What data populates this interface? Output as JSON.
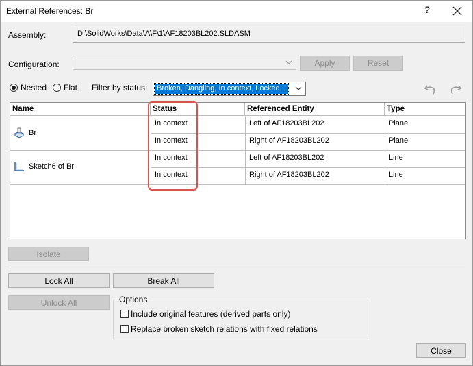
{
  "window": {
    "title": "External References: Br",
    "help_label": "?"
  },
  "assembly": {
    "label": "Assembly:",
    "value": "D:\\SolidWorks\\Data\\A\\F\\1\\AF18203BL202.SLDASM"
  },
  "configuration": {
    "label": "Configuration:",
    "value": "",
    "apply_label": "Apply",
    "reset_label": "Reset"
  },
  "view_mode": {
    "nested_label": "Nested",
    "flat_label": "Flat",
    "selected": "Nested"
  },
  "filter": {
    "label": "Filter by status:",
    "value": "Broken, Dangling, In context, Locked..."
  },
  "table": {
    "headers": {
      "name": "Name",
      "status": "Status",
      "entity": "Referenced Entity",
      "type": "Type"
    },
    "groups": [
      {
        "name": "Br",
        "icon": "part-feature-icon"
      },
      {
        "name": "Sketch6  of  Br",
        "icon": "sketch-icon"
      }
    ],
    "rows": [
      {
        "status": "In context",
        "entity": "Left of AF18203BL202",
        "type": "Plane"
      },
      {
        "status": "In context",
        "entity": "Right of AF18203BL202",
        "type": "Plane"
      },
      {
        "status": "In context",
        "entity": "Left of AF18203BL202",
        "type": "Line"
      },
      {
        "status": "In context",
        "entity": "Right of AF18203BL202",
        "type": "Line"
      }
    ]
  },
  "buttons": {
    "isolate": "Isolate",
    "lock_all": "Lock All",
    "break_all": "Break All",
    "unlock_all": "Unlock All",
    "close": "Close"
  },
  "options": {
    "title": "Options",
    "include_original": "Include original features (derived parts only)",
    "replace_broken": "Replace broken sketch relations with fixed relations"
  },
  "colors": {
    "highlight": "#d9534f",
    "selection": "#0078d7"
  }
}
